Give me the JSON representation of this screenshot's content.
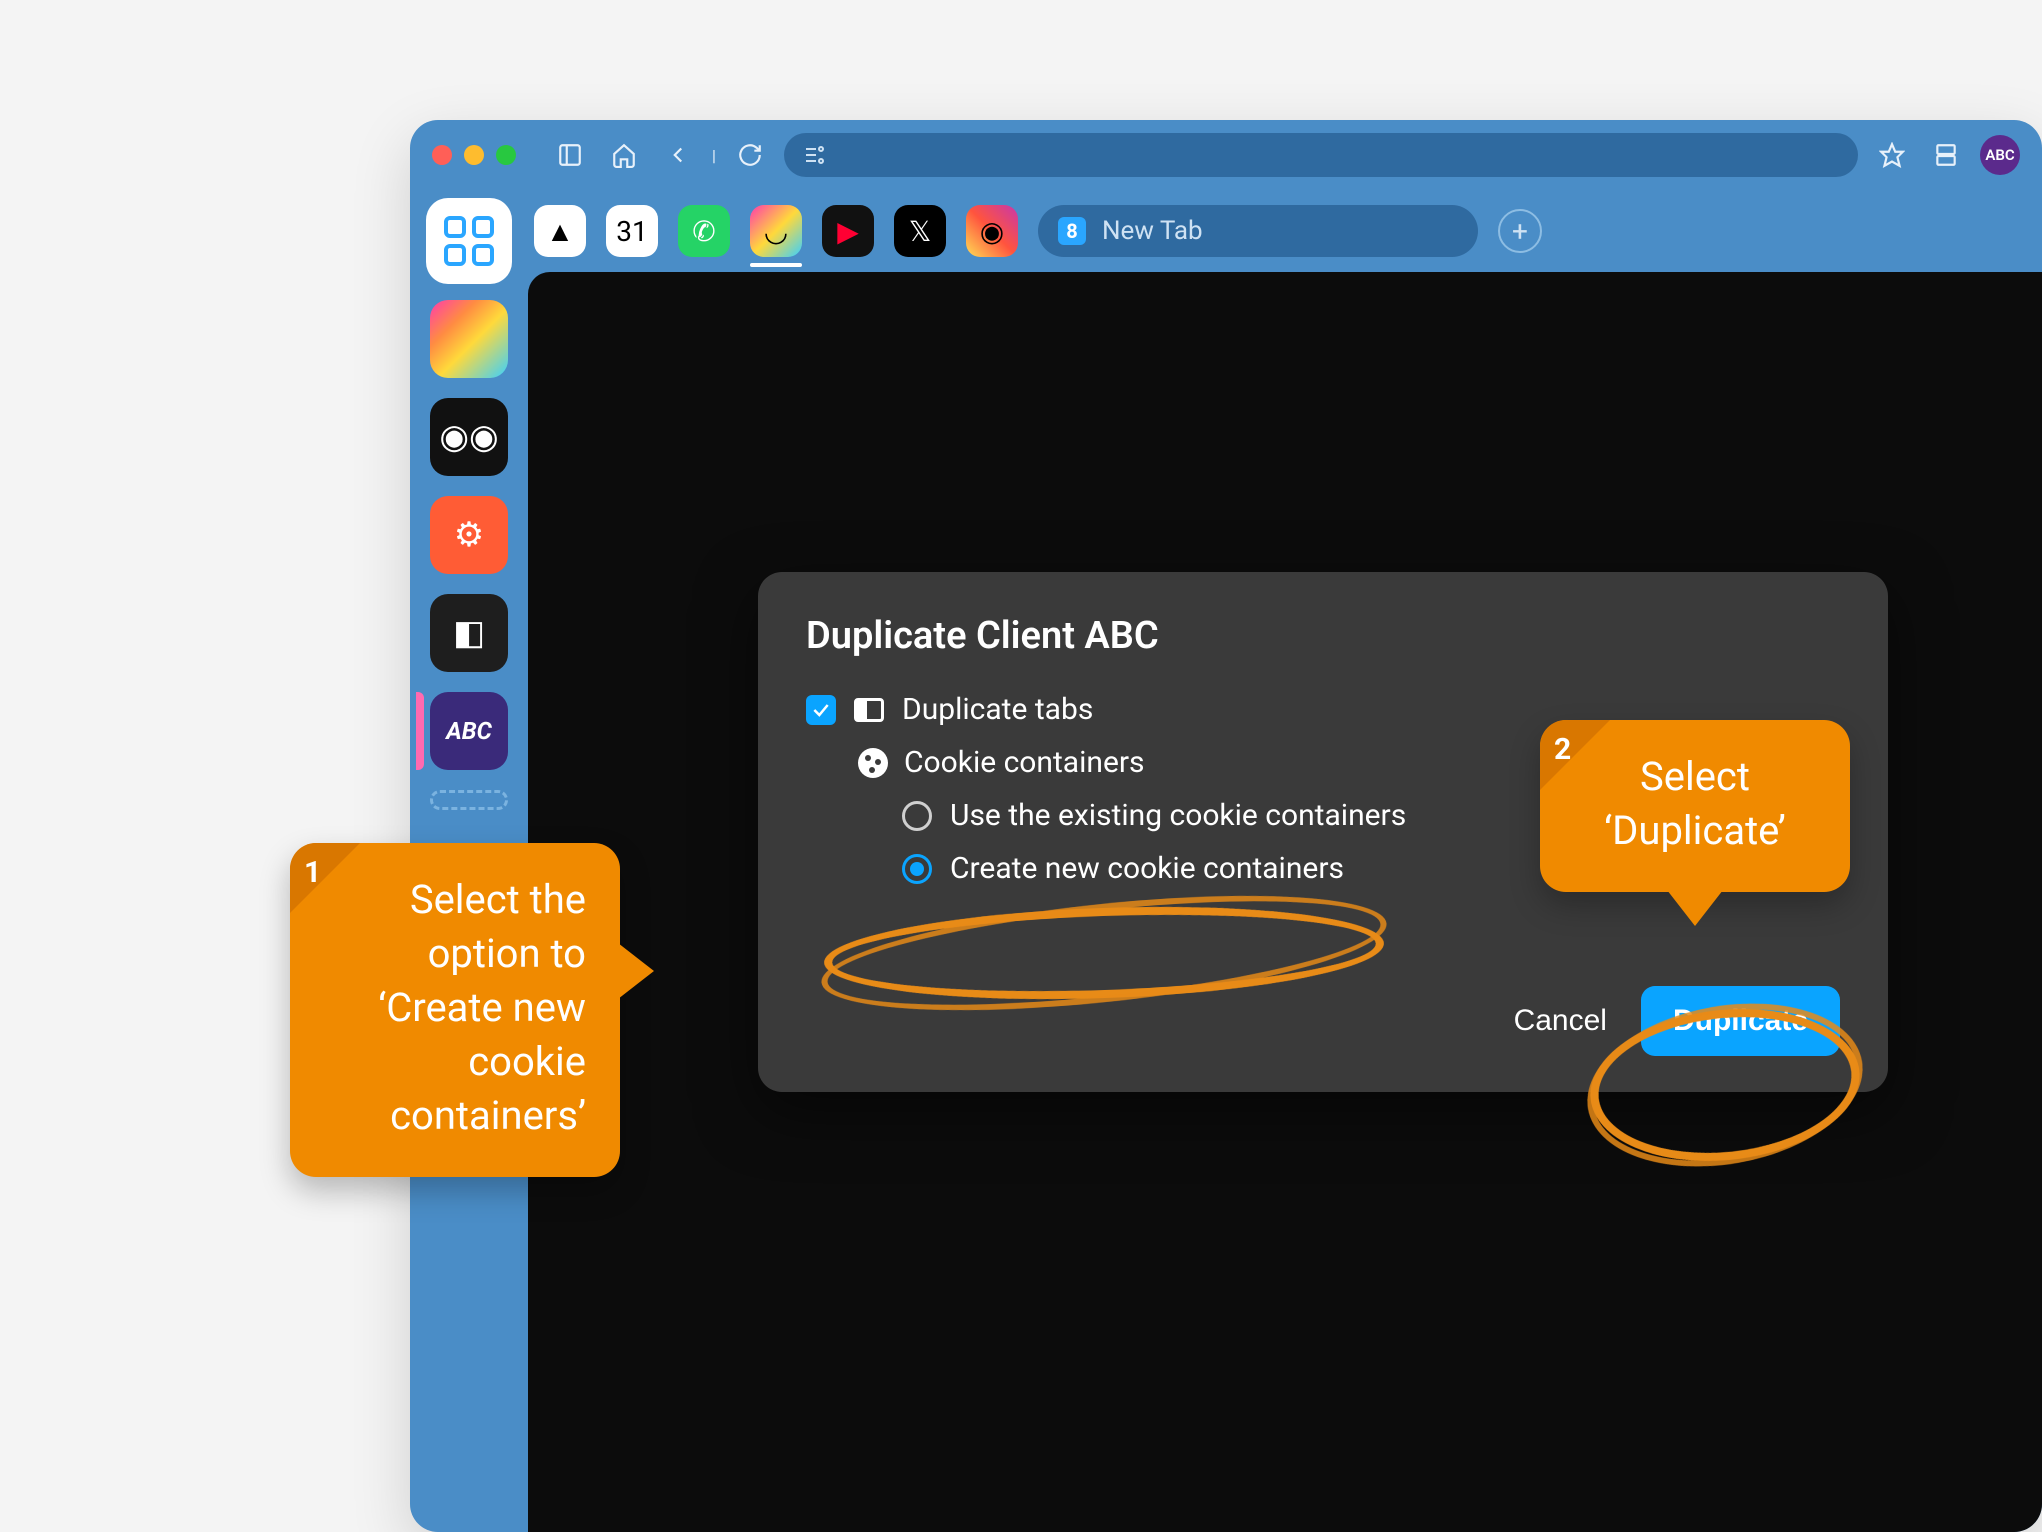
{
  "traffic_lights": [
    "close",
    "minimize",
    "zoom"
  ],
  "chrome_icons": {
    "sidebar": "sidebar-icon",
    "home": "home-icon",
    "back": "back-icon",
    "separator": "|",
    "reload": "reload-icon",
    "site_settings": "tune-icon",
    "star": "star-icon",
    "panel": "panel-icon"
  },
  "avatar_label": "ABC",
  "left_rail": [
    {
      "name": "apps-grid",
      "kind": "grid",
      "selected": true
    },
    {
      "name": "clickup-workspace",
      "kind": "clickup"
    },
    {
      "name": "hootsuite-workspace",
      "kind": "hootsuite",
      "glyph": "◉◉"
    },
    {
      "name": "hubspot-workspace",
      "kind": "hubspot",
      "glyph": "⚙"
    },
    {
      "name": "figma-workspace",
      "kind": "figma",
      "glyph": "◧"
    },
    {
      "name": "abc-workspace",
      "kind": "abc",
      "glyph": "ABC",
      "pink_edge": true
    },
    {
      "name": "add-workspace",
      "kind": "dashed"
    }
  ],
  "favorites": [
    {
      "name": "google-drive",
      "cls": "drive",
      "glyph": "▲"
    },
    {
      "name": "google-calendar",
      "cls": "cal",
      "glyph": "31"
    },
    {
      "name": "whatsapp",
      "cls": "wa",
      "glyph": "✆"
    },
    {
      "name": "clickup",
      "cls": "cu",
      "glyph": "◡",
      "active": true
    },
    {
      "name": "youtube",
      "cls": "yt",
      "glyph": "▶"
    },
    {
      "name": "x-twitter",
      "cls": "x",
      "glyph": "𝕏"
    },
    {
      "name": "instagram",
      "cls": "ig",
      "glyph": "◉"
    }
  ],
  "tab": {
    "icon_letter": "8",
    "label": "New Tab"
  },
  "dialog": {
    "title": "Duplicate Client ABC",
    "duplicate_tabs_label": "Duplicate tabs",
    "duplicate_tabs_checked": true,
    "cookie_header": "Cookie containers",
    "radio_existing": "Use the existing cookie containers",
    "radio_new": "Create new cookie containers",
    "selected_radio": "new",
    "cancel": "Cancel",
    "confirm": "Duplicate"
  },
  "callouts": {
    "c1": {
      "num": "1",
      "text": "Select the option to ‘Create new cookie containers’"
    },
    "c2": {
      "num": "2",
      "text": "Select ‘Duplicate’"
    }
  }
}
